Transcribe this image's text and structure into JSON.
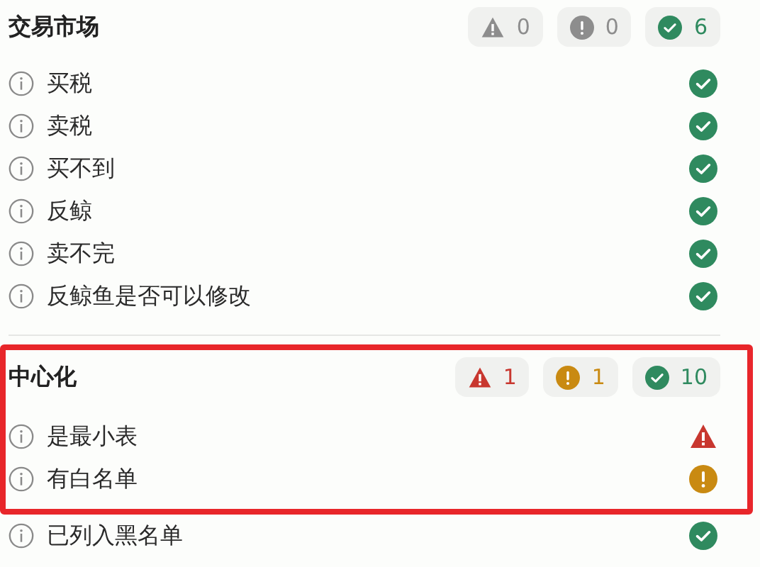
{
  "sections": [
    {
      "title": "交易市场",
      "highlighted": false,
      "badges": [
        {
          "kind": "danger",
          "count": "0",
          "active": false
        },
        {
          "kind": "warning",
          "count": "0",
          "active": false
        },
        {
          "kind": "pass",
          "count": "6",
          "active": true
        }
      ],
      "rows": [
        {
          "label": "买税",
          "kind": "pass"
        },
        {
          "label": "卖税",
          "kind": "pass"
        },
        {
          "label": "买不到",
          "kind": "pass"
        },
        {
          "label": "反鲸",
          "kind": "pass"
        },
        {
          "label": "卖不完",
          "kind": "pass"
        },
        {
          "label": "反鲸鱼是否可以修改",
          "kind": "pass"
        }
      ]
    },
    {
      "title": "中心化",
      "highlighted": true,
      "badges": [
        {
          "kind": "danger",
          "count": "1",
          "active": true
        },
        {
          "kind": "warning",
          "count": "1",
          "active": true
        },
        {
          "kind": "pass",
          "count": "10",
          "active": true
        }
      ],
      "rows": [
        {
          "label": "是最小表",
          "kind": "danger"
        },
        {
          "label": "有白名单",
          "kind": "warning"
        }
      ],
      "rows_outside_frame": [
        {
          "label": "已列入黑名单",
          "kind": "pass"
        }
      ]
    }
  ]
}
